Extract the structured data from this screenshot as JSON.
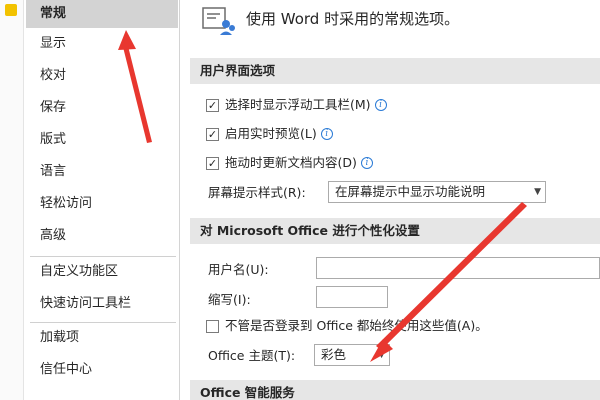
{
  "nav": {
    "items": [
      "常规",
      "显示",
      "校对",
      "保存",
      "版式",
      "语言",
      "轻松访问",
      "高级",
      "自定义功能区",
      "快速访问工具栏",
      "加载项",
      "信任中心"
    ]
  },
  "header": {
    "text": "使用 Word 时采用的常规选项。",
    "icon": "general-options-icon"
  },
  "sections": {
    "ui": "用户界面选项",
    "personal": "对 Microsoft Office 进行个性化设置",
    "smart": "Office 智能服务"
  },
  "ui_options": {
    "mini_toolbar": "选择时显示浮动工具栏(M)",
    "live_preview": "启用实时预览(L)",
    "update_drag": "拖动时更新文档内容(D)",
    "screentip_label": "屏幕提示样式(R):",
    "screentip_value": "在屏幕提示中显示功能说明"
  },
  "personal": {
    "username_label": "用户名(U):",
    "username_value": "",
    "initials_label": "缩写(I):",
    "initials_value": "",
    "always_use": "不管是否登录到 Office 都始终使用这些值(A)。",
    "theme_label": "Office 主题(T):",
    "theme_value": "彩色"
  },
  "colors": {
    "annotation": "#e8372f",
    "selected_nav": "#d3d3d3",
    "section_bar": "#e6e6e6"
  }
}
